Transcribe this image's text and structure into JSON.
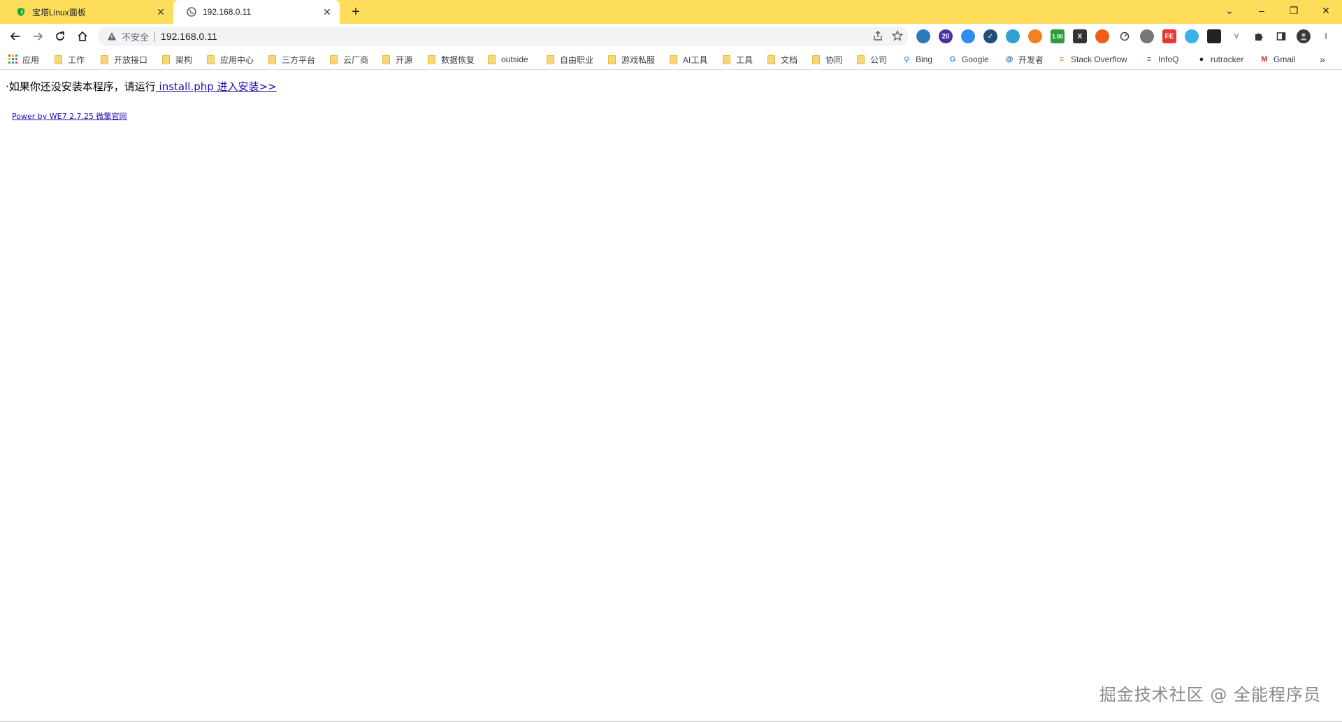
{
  "browser": {
    "tabs": [
      {
        "title": "宝塔Linux面板",
        "icon": "baota-shield-icon",
        "active": false
      },
      {
        "title": "192.168.0.11",
        "icon": "globe-icon",
        "active": true
      }
    ],
    "new_tab_label": "+",
    "window_controls": {
      "collapse": "⌄",
      "minimize": "–",
      "restore": "❐",
      "close": "✕"
    },
    "accent_color": "#fedd5b"
  },
  "toolbar": {
    "security_label": "不安全",
    "url": "192.168.0.11"
  },
  "extensions": [
    {
      "name": "globe-ext-icon",
      "color": "#2a7ab8",
      "label": ""
    },
    {
      "name": "graduate-ext-icon",
      "color": "#4b2fa5",
      "label": "20"
    },
    {
      "name": "layers-ext-icon",
      "color": "#2d8cf0",
      "label": ""
    },
    {
      "name": "check-ext-icon",
      "color": "#1f4e79",
      "label": "✓"
    },
    {
      "name": "leaf-ext-icon",
      "color": "#2fa0d0",
      "label": ""
    },
    {
      "name": "orange-ext-icon",
      "color": "#f58220",
      "label": ""
    },
    {
      "name": "android-ext-icon",
      "color": "#2e9d3a",
      "label": "1.00"
    },
    {
      "name": "x-ext-icon",
      "color": "#333333",
      "label": "X"
    },
    {
      "name": "firefox-ext-icon",
      "color": "#f25c19",
      "label": ""
    },
    {
      "name": "speed-ext-icon",
      "color": "#444444",
      "label": ""
    },
    {
      "name": "settings-ext-icon",
      "color": "#777777",
      "label": ""
    },
    {
      "name": "fe-ext-icon",
      "color": "#e53935",
      "label": "FE"
    },
    {
      "name": "bird-ext-icon",
      "color": "#3bb2e6",
      "label": ""
    },
    {
      "name": "store-ext-icon",
      "color": "#222222",
      "label": ""
    },
    {
      "name": "vue-ext-icon",
      "color": "#888888",
      "label": "V"
    },
    {
      "name": "puzzle-ext-icon",
      "color": "#333333",
      "label": ""
    },
    {
      "name": "sidepanel-ext-icon",
      "color": "#333333",
      "label": ""
    },
    {
      "name": "profile-avatar-icon",
      "color": "#333333",
      "label": ""
    },
    {
      "name": "menu-kebab-icon",
      "color": "#333333",
      "label": "⋮"
    }
  ],
  "bookmarks": [
    {
      "label": "应用",
      "type": "apps"
    },
    {
      "label": "工作",
      "type": "folder"
    },
    {
      "label": "开放接口",
      "type": "folder"
    },
    {
      "label": "架构",
      "type": "folder"
    },
    {
      "label": "应用中心",
      "type": "folder"
    },
    {
      "label": "三方平台",
      "type": "folder"
    },
    {
      "label": "云厂商",
      "type": "folder"
    },
    {
      "label": "开源",
      "type": "folder"
    },
    {
      "label": "数据恢复",
      "type": "folder"
    },
    {
      "label": "outside",
      "type": "folder"
    },
    {
      "label": "自由职业",
      "type": "folder"
    },
    {
      "label": "游戏私服",
      "type": "folder"
    },
    {
      "label": "AI工具",
      "type": "folder"
    },
    {
      "label": "工具",
      "type": "folder"
    },
    {
      "label": "文档",
      "type": "folder"
    },
    {
      "label": "协同",
      "type": "folder"
    },
    {
      "label": "公司",
      "type": "folder"
    },
    {
      "label": "Bing",
      "type": "site",
      "icon": "search-icon"
    },
    {
      "label": "Google",
      "type": "site",
      "icon": "google-icon"
    },
    {
      "label": "开发者",
      "type": "site",
      "icon": "developer-icon"
    },
    {
      "label": "Stack Overflow",
      "type": "site",
      "icon": "stackoverflow-icon"
    },
    {
      "label": "InfoQ",
      "type": "site",
      "icon": "infoq-icon"
    },
    {
      "label": "rutracker",
      "type": "site",
      "icon": "rutracker-icon"
    },
    {
      "label": "Gmail",
      "type": "site",
      "icon": "gmail-icon"
    }
  ],
  "bookmarks_overflow": "»",
  "page": {
    "notice_prefix": "·如果你还没安装本程序，请运行",
    "notice_link": " install.php 进入安装>>",
    "power_link": "Power by WE7 2.7.25  微擎官网",
    "watermark": "掘金技术社区 @ 全能程序员"
  }
}
